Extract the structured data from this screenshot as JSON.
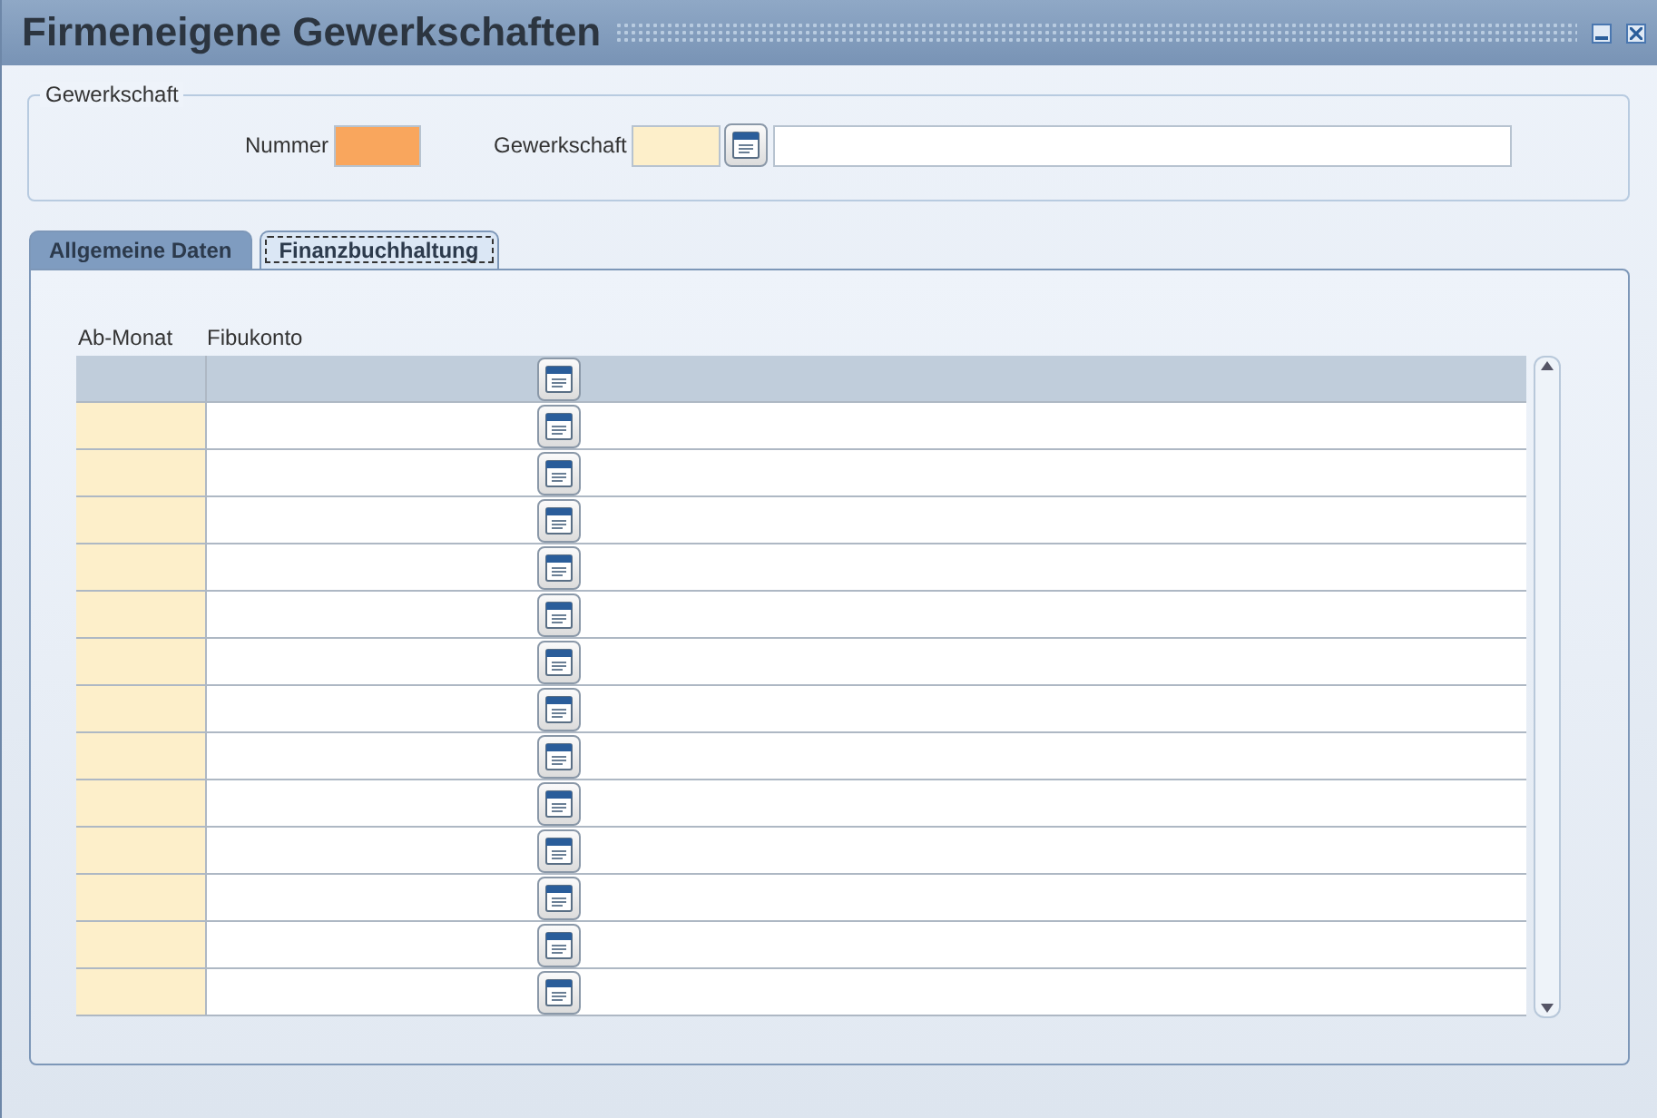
{
  "window": {
    "title": "Firmeneigene Gewerkschaften"
  },
  "group": {
    "title": "Gewerkschaft",
    "fields": [
      {
        "label": "Nummer",
        "kind": "required"
      },
      {
        "label": "Gewerkschaft",
        "kind": "lookup"
      }
    ]
  },
  "tabs": [
    {
      "label": "Allgemeine Daten",
      "selected": false
    },
    {
      "label": "Finanzbuchhaltung",
      "selected": true
    }
  ],
  "table": {
    "columns": [
      "Ab-Monat",
      "Fibukonto"
    ],
    "rows": [
      {
        "selected": true
      },
      {
        "selected": false
      },
      {
        "selected": false
      },
      {
        "selected": false
      },
      {
        "selected": false
      },
      {
        "selected": false
      },
      {
        "selected": false
      },
      {
        "selected": false
      },
      {
        "selected": false
      },
      {
        "selected": false
      },
      {
        "selected": false
      },
      {
        "selected": false
      },
      {
        "selected": false
      },
      {
        "selected": false
      }
    ]
  }
}
